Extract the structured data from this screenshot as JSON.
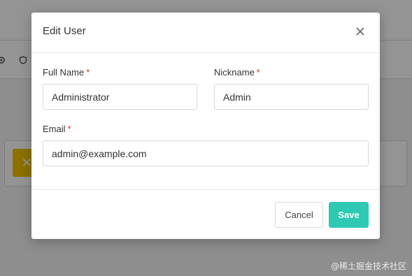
{
  "modal": {
    "title": "Edit User",
    "fields": {
      "full_name": {
        "label": "Full Name",
        "required_mark": "*",
        "value": "Administrator"
      },
      "nickname": {
        "label": "Nickname",
        "required_mark": "*",
        "value": "Admin"
      },
      "email": {
        "label": "Email",
        "required_mark": "*",
        "value": "admin@example.com"
      }
    },
    "buttons": {
      "cancel": "Cancel",
      "save": "Save"
    }
  },
  "background": {
    "toolbar_icons": [
      "gear-icon",
      "shield-icon"
    ],
    "warning_button_icon": "close-icon"
  },
  "watermark": "@稀土掘金技术社区",
  "colors": {
    "primary": "#2ec9b3",
    "required": "#d33333",
    "warning": "#f2c200",
    "overlay": "rgba(0,0,0,0.42)"
  }
}
